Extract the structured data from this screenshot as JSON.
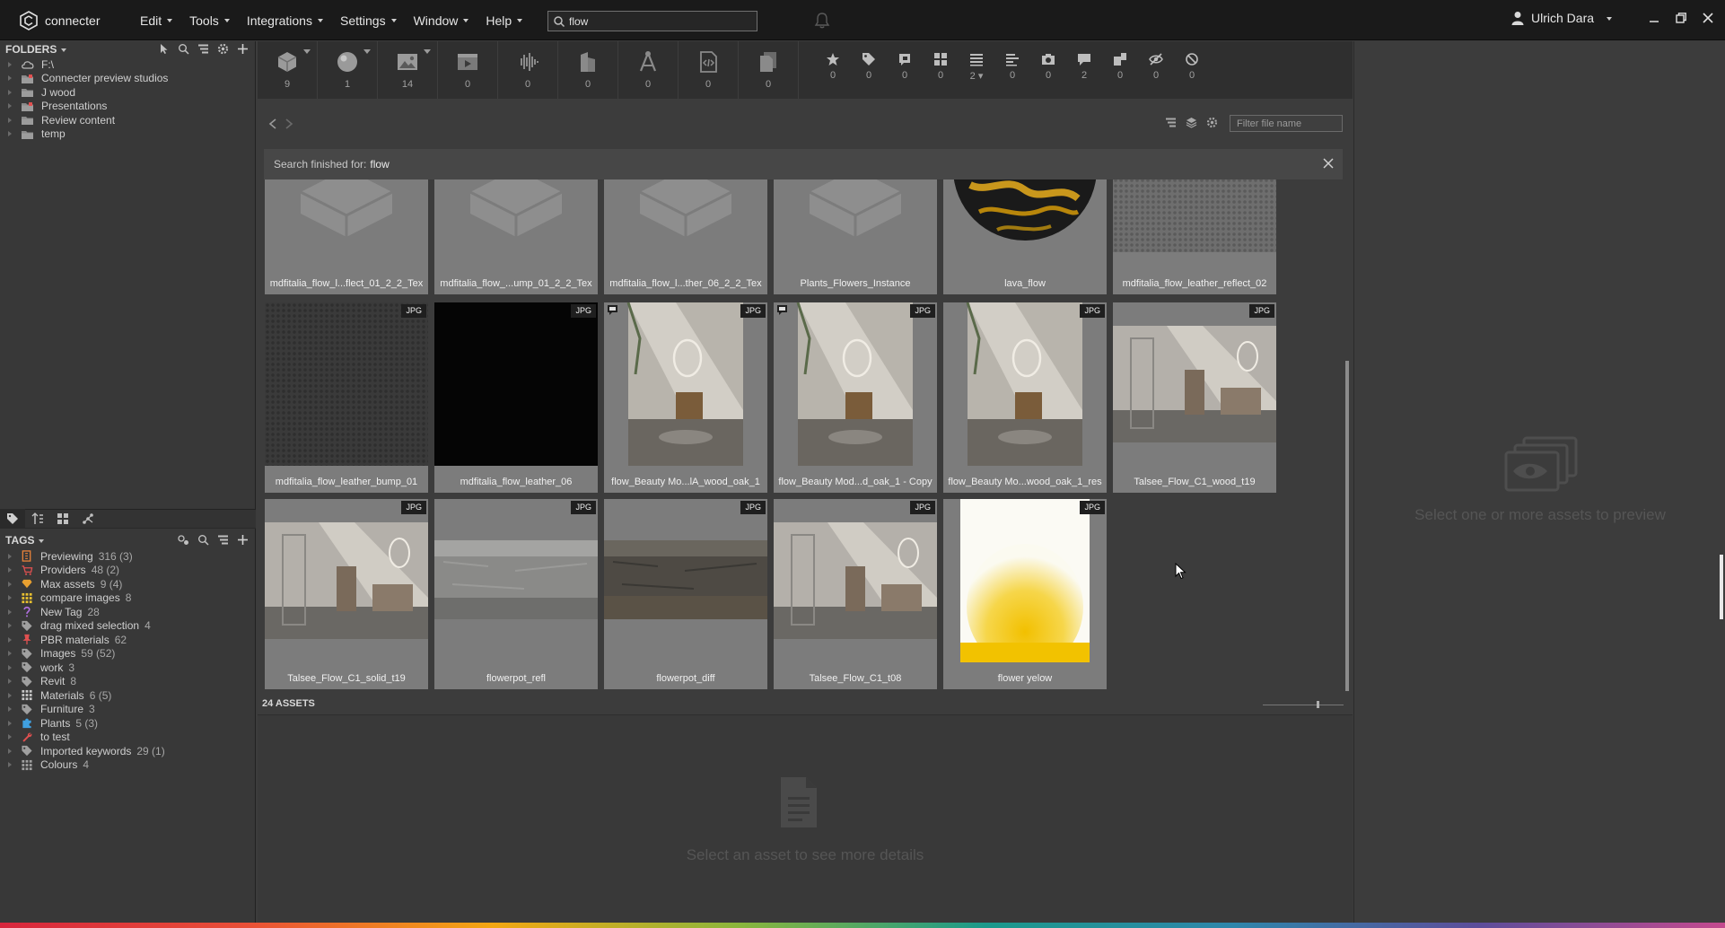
{
  "app": {
    "name": "connecter"
  },
  "menu": [
    {
      "label": "Edit"
    },
    {
      "label": "Tools"
    },
    {
      "label": "Integrations"
    },
    {
      "label": "Settings"
    },
    {
      "label": "Window"
    },
    {
      "label": "Help"
    }
  ],
  "search": {
    "value": "flow"
  },
  "user": {
    "name": "Ulrich Dara"
  },
  "folders": {
    "header": "FOLDERS",
    "items": [
      {
        "label": "F:\\",
        "icon": "cloud-icon"
      },
      {
        "label": "Connecter preview studios",
        "icon": "folder-color-icon"
      },
      {
        "label": "J wood",
        "icon": "folder-icon"
      },
      {
        "label": "Presentations",
        "icon": "folder-color-icon"
      },
      {
        "label": "Review content",
        "icon": "folder-icon"
      },
      {
        "label": "temp",
        "icon": "folder-icon"
      }
    ]
  },
  "tags": {
    "header": "TAGS",
    "items": [
      {
        "label": "Previewing",
        "count": "316 (3)",
        "icon": "previewing-icon",
        "color": "#e8823a"
      },
      {
        "label": "Providers",
        "count": "48 (2)",
        "icon": "cart-icon",
        "color": "#e05050"
      },
      {
        "label": "Max assets",
        "count": "9 (4)",
        "icon": "diamond-icon",
        "color": "#e8a030"
      },
      {
        "label": "compare images",
        "count": "8",
        "icon": "grid-icon",
        "color": "#e8c030"
      },
      {
        "label": "New Tag",
        "count": "28",
        "icon": "question-icon",
        "color": "#b070e0"
      },
      {
        "label": "drag mixed selection",
        "count": "4",
        "icon": "tag-icon",
        "color": "#a0a0a0"
      },
      {
        "label": "PBR materials",
        "count": "62",
        "icon": "pin-icon",
        "color": "#e05050"
      },
      {
        "label": "Images",
        "count": "59 (52)",
        "icon": "tag-icon",
        "color": "#a0a0a0"
      },
      {
        "label": "work",
        "count": "3",
        "icon": "tag-icon",
        "color": "#a0a0a0"
      },
      {
        "label": "Revit",
        "count": "8",
        "icon": "tag-icon",
        "color": "#a0a0a0"
      },
      {
        "label": "Materials",
        "count": "6 (5)",
        "icon": "grid-icon",
        "color": "#c8c8c8"
      },
      {
        "label": "Furniture",
        "count": "3",
        "icon": "tag-icon",
        "color": "#a0a0a0"
      },
      {
        "label": "Plants",
        "count": "5 (3)",
        "icon": "puzzle-icon",
        "color": "#40a0e0"
      },
      {
        "label": "to test",
        "count": "",
        "icon": "wrench-icon",
        "color": "#e05050"
      },
      {
        "label": "Imported keywords",
        "count": "29 (1)",
        "icon": "tag-icon",
        "color": "#a0a0a0"
      },
      {
        "label": "Colours",
        "count": "4",
        "icon": "grid-icon",
        "color": "#a0a0a0"
      }
    ]
  },
  "type_filters": [
    {
      "icon": "model-icon",
      "count": "9",
      "caret": true
    },
    {
      "icon": "material-icon",
      "count": "1",
      "caret": true
    },
    {
      "icon": "image-icon",
      "count": "14",
      "caret": true
    },
    {
      "icon": "video-icon",
      "count": "0",
      "caret": false
    },
    {
      "icon": "audio-icon",
      "count": "0",
      "caret": false
    },
    {
      "icon": "building-icon",
      "count": "0",
      "caret": false
    },
    {
      "icon": "vector-icon",
      "count": "0",
      "caret": false
    },
    {
      "icon": "code-icon",
      "count": "0",
      "caret": false
    },
    {
      "icon": "document-icon",
      "count": "0",
      "caret": false
    }
  ],
  "meta_filters": [
    {
      "icon": "star-icon",
      "count": "0"
    },
    {
      "icon": "tag-icon",
      "count": "0"
    },
    {
      "icon": "comment-flag-icon",
      "count": "0"
    },
    {
      "icon": "grid-icon",
      "count": "0"
    },
    {
      "icon": "list-icon",
      "count": "2 ▾"
    },
    {
      "icon": "align-icon",
      "count": "0"
    },
    {
      "icon": "camera-icon",
      "count": "0"
    },
    {
      "icon": "chat-icon",
      "count": "2"
    },
    {
      "icon": "stack-icon",
      "count": "0"
    },
    {
      "icon": "hidden-icon",
      "count": "0"
    },
    {
      "icon": "block-icon",
      "count": "0"
    }
  ],
  "filter": {
    "placeholder": "Filter file name"
  },
  "search_banner": {
    "prefix": "Search finished for:",
    "term": "flow"
  },
  "assets": [
    {
      "name": "mdfitalia_flow_l...flect_01_2_2_Tex",
      "thumb": "placeholder",
      "badge": ""
    },
    {
      "name": "mdfitalia_flow_...ump_01_2_2_Tex",
      "thumb": "placeholder",
      "badge": ""
    },
    {
      "name": "mdfitalia_flow_l...ther_06_2_2_Tex",
      "thumb": "placeholder",
      "badge": ""
    },
    {
      "name": "Plants_Flowers_Instance",
      "thumb": "placeholder",
      "badge": ""
    },
    {
      "name": "lava_flow",
      "thumb": "lava",
      "badge": ""
    },
    {
      "name": "mdfitalia_flow_leather_reflect_02",
      "thumb": "leather-light",
      "badge": ""
    },
    {
      "name": "mdfitalia_flow_leather_bump_01",
      "thumb": "leather-dark",
      "badge": "JPG"
    },
    {
      "name": "mdfitalia_flow_leather_06",
      "thumb": "black",
      "badge": "JPG"
    },
    {
      "name": "flow_Beauty Mo...lA_wood_oak_1",
      "thumb": "bathroom-portrait",
      "badge": "JPG",
      "comment": true
    },
    {
      "name": "flow_Beauty Mod...d_oak_1 - Copy",
      "thumb": "bathroom-portrait",
      "badge": "JPG",
      "comment": true
    },
    {
      "name": "flow_Beauty Mo...wood_oak_1_res",
      "thumb": "bathroom-portrait",
      "badge": "JPG"
    },
    {
      "name": "Talsee_Flow_C1_wood_t19",
      "thumb": "bathroom-wide",
      "badge": "JPG"
    },
    {
      "name": "Talsee_Flow_C1_solid_t19",
      "thumb": "bathroom-wide",
      "badge": "JPG"
    },
    {
      "name": "flowerpot_refl",
      "thumb": "concrete-light",
      "badge": "JPG"
    },
    {
      "name": "flowerpot_diff",
      "thumb": "concrete-dark",
      "badge": "JPG"
    },
    {
      "name": "Talsee_Flow_C1_t08",
      "thumb": "bathroom-wide",
      "badge": "JPG"
    },
    {
      "name": "flower yelow",
      "thumb": "yellow-flower",
      "badge": "JPG"
    }
  ],
  "footer": {
    "asset_count": "24 ASSETS"
  },
  "details": {
    "empty_text": "Select an asset to see more details"
  },
  "preview": {
    "empty_text": "Select one or more assets to preview"
  }
}
